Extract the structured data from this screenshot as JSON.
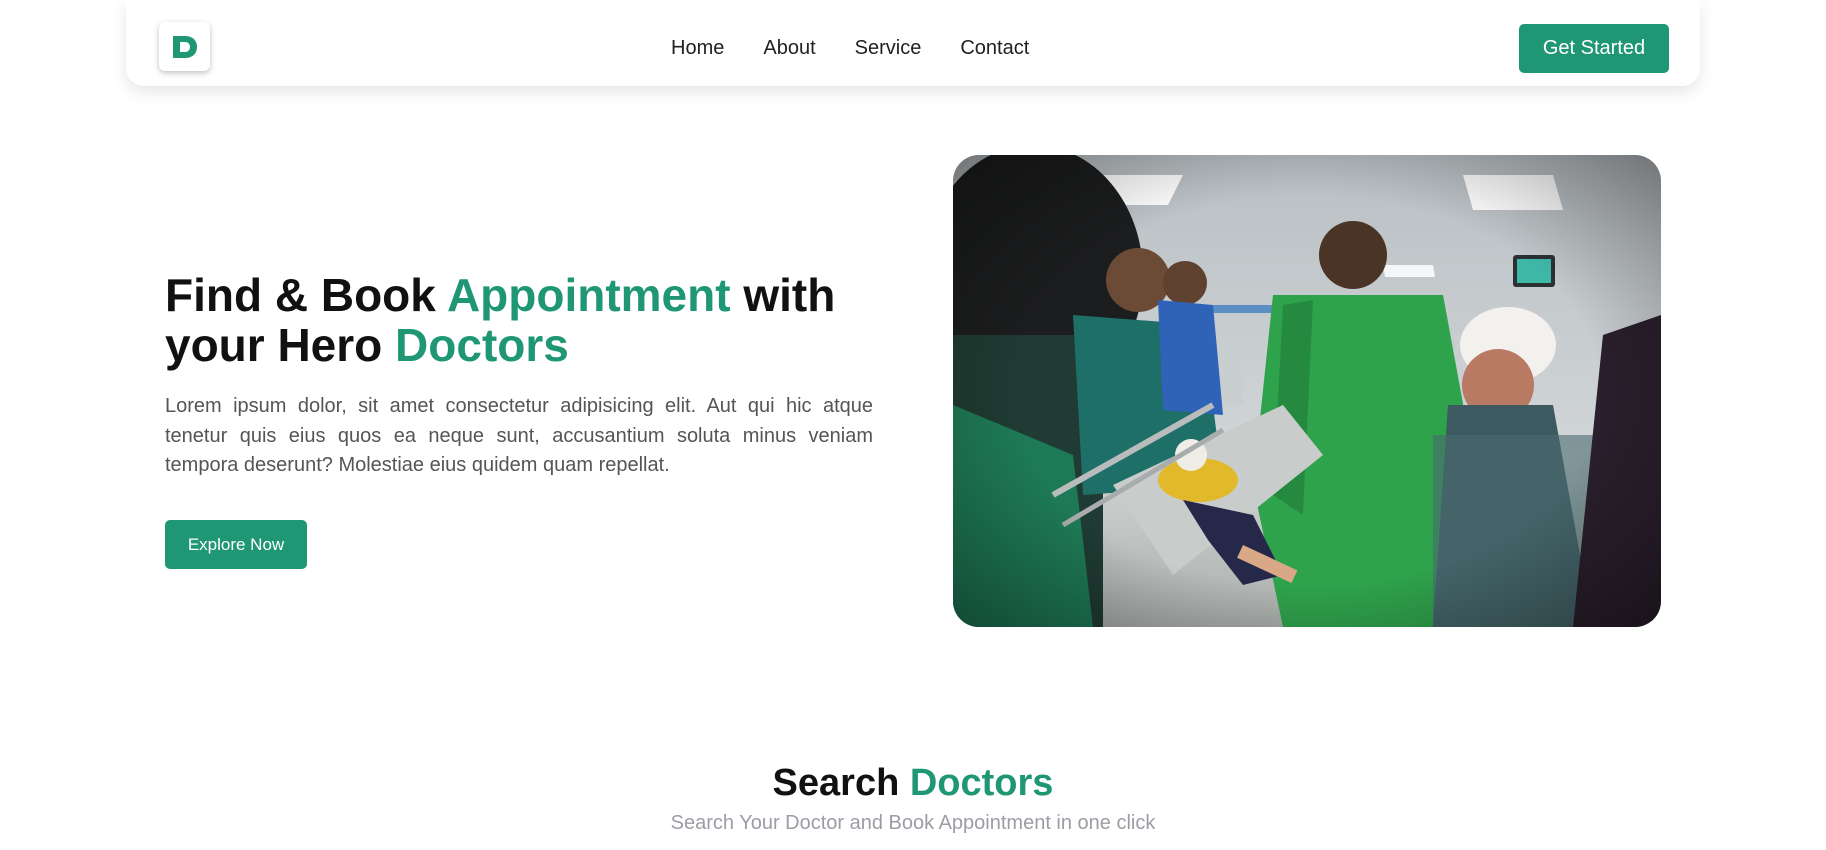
{
  "nav": {
    "logo_icon": "d-letter-logo-icon",
    "links": [
      "Home",
      "About",
      "Service",
      "Contact"
    ],
    "cta_label": "Get Started"
  },
  "hero": {
    "title_part1": "Find & Book ",
    "title_highlight1": "Appointment",
    "title_part2": " with",
    "title_part3": "your Hero ",
    "title_highlight2": "Doctors",
    "description": "Lorem ipsum dolor, sit amet consectetur adipisicing elit. Aut qui hic atque tenetur quis eius quos ea neque sunt, accusantium soluta minus veniam tempora deserunt? Molestiae eius quidem quam repellat.",
    "button_label": "Explore Now",
    "image_subject": "hospital-emergency-room-photo"
  },
  "search": {
    "title_part1": "Search ",
    "title_highlight": "Doctors",
    "subtitle": "Search Your Doctor and Book Appointment in one click"
  },
  "colors": {
    "accent": "#209774",
    "text_dark": "#111111",
    "text_muted": "#555555",
    "subtitle": "#9a9ea4"
  }
}
